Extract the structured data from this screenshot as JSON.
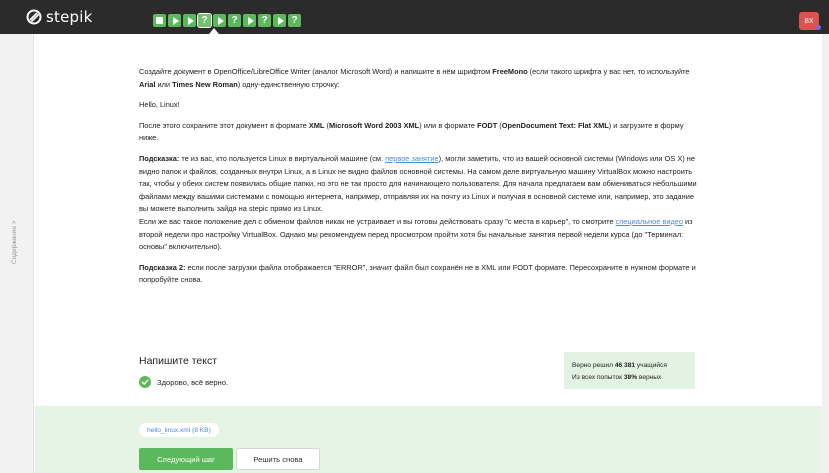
{
  "header": {
    "logo_text": "stepik",
    "steps": [
      {
        "icon": "text-step-icon"
      },
      {
        "icon": "video-step-icon"
      },
      {
        "icon": "video-step-icon"
      },
      {
        "icon": "quiz-step-icon",
        "label": "?",
        "active": true
      },
      {
        "icon": "video-step-icon"
      },
      {
        "icon": "quiz-step-icon",
        "label": "?"
      },
      {
        "icon": "video-step-icon"
      },
      {
        "icon": "quiz-step-icon",
        "label": "?"
      },
      {
        "icon": "video-step-icon"
      },
      {
        "icon": "quiz-step-icon",
        "label": "?"
      }
    ],
    "avatar_initials": "BX",
    "avatar_color": "#d9534f"
  },
  "sidebar": {
    "label": "Содержание >"
  },
  "task": {
    "p1_a": "Создайте документ в OpenOffice/LibreOffice Writer (аналог Microsoft Word) и напишите в нём шрифтом ",
    "p1_b": "FreeMono",
    "p1_c": " (если такого шрифта у вас нет, то используйте ",
    "p1_d": "Arial",
    "p1_e": " или ",
    "p1_f": "Times New Roman",
    "p1_g": ") одну-единственную строчку:",
    "p2": "Hello, Linux!",
    "p3_a": "После этого сохраните этот документ в формате ",
    "p3_b": "XML",
    "p3_c": " (",
    "p3_d": "Microsoft Word 2003 XML",
    "p3_e": ") или в формате ",
    "p3_f": "FODT",
    "p3_g": " (",
    "p3_h": "OpenDocument Text: Flat XML",
    "p3_i": ") и загрузите в форму ниже.",
    "hint1_label": "Подсказка:",
    "hint1_a": " те из вас, кто пользуется Linux в виртуальной машине (см. ",
    "hint1_link": "первое занятие",
    "hint1_b": "), могли заметить, что из вашей основной системы (Windows или OS X) не видно папок и файлов, созданных внутри Linux, а в Linux не видно файлов основной системы. На самом деле виртуальную машину VirtualBox можно настроить так, чтобы у обеих систем появились общие папки, но это не так просто для начинающего пользователя. Для начала предлагаем вам обмениваться небольшими файлами между вашими системами с помощью интернета, например, отправляя их на почту из Linux и получая в основной системе или, например, это задание вы можете выполнить зайдя на stepic прямо из Linux.",
    "hint1_c": "Если же вас такое положение дел с обменом файлов никак не устраивает и вы готовы действовать сразу \"с места в карьер\", то смотрите ",
    "hint1_link2": "специальное видео",
    "hint1_d": " из второй недели про настройку VirtualBox. Однако мы рекомендуем перед просмотром пройти хотя бы начальные занятия первой недели курса (до \"Терминал: основы\" включительно).",
    "hint2_label": "Подсказка 2:",
    "hint2_text": " если после загрузки файла отображается \"ERROR\", значит файл был сохранён не в XML или FODT формате. Пересохраните в нужном формате и попробуйте снова.",
    "title": "Напишите текст",
    "result": "Здорово, всё верно."
  },
  "stats": {
    "line1_a": "Верно решил ",
    "line1_b": "46 381",
    "line1_c": " учащийся",
    "line2_a": "Из всех попыток ",
    "line2_b": "38%",
    "line2_c": " верных"
  },
  "footer": {
    "file_name": "hello_linux.xml (8 KB)",
    "next_label": "Следующий шаг",
    "retry_label": "Решить снова"
  },
  "colors": {
    "accent_green": "#5cb85c",
    "link_blue": "#4a8bd1",
    "topbar": "#2b2b2b"
  }
}
